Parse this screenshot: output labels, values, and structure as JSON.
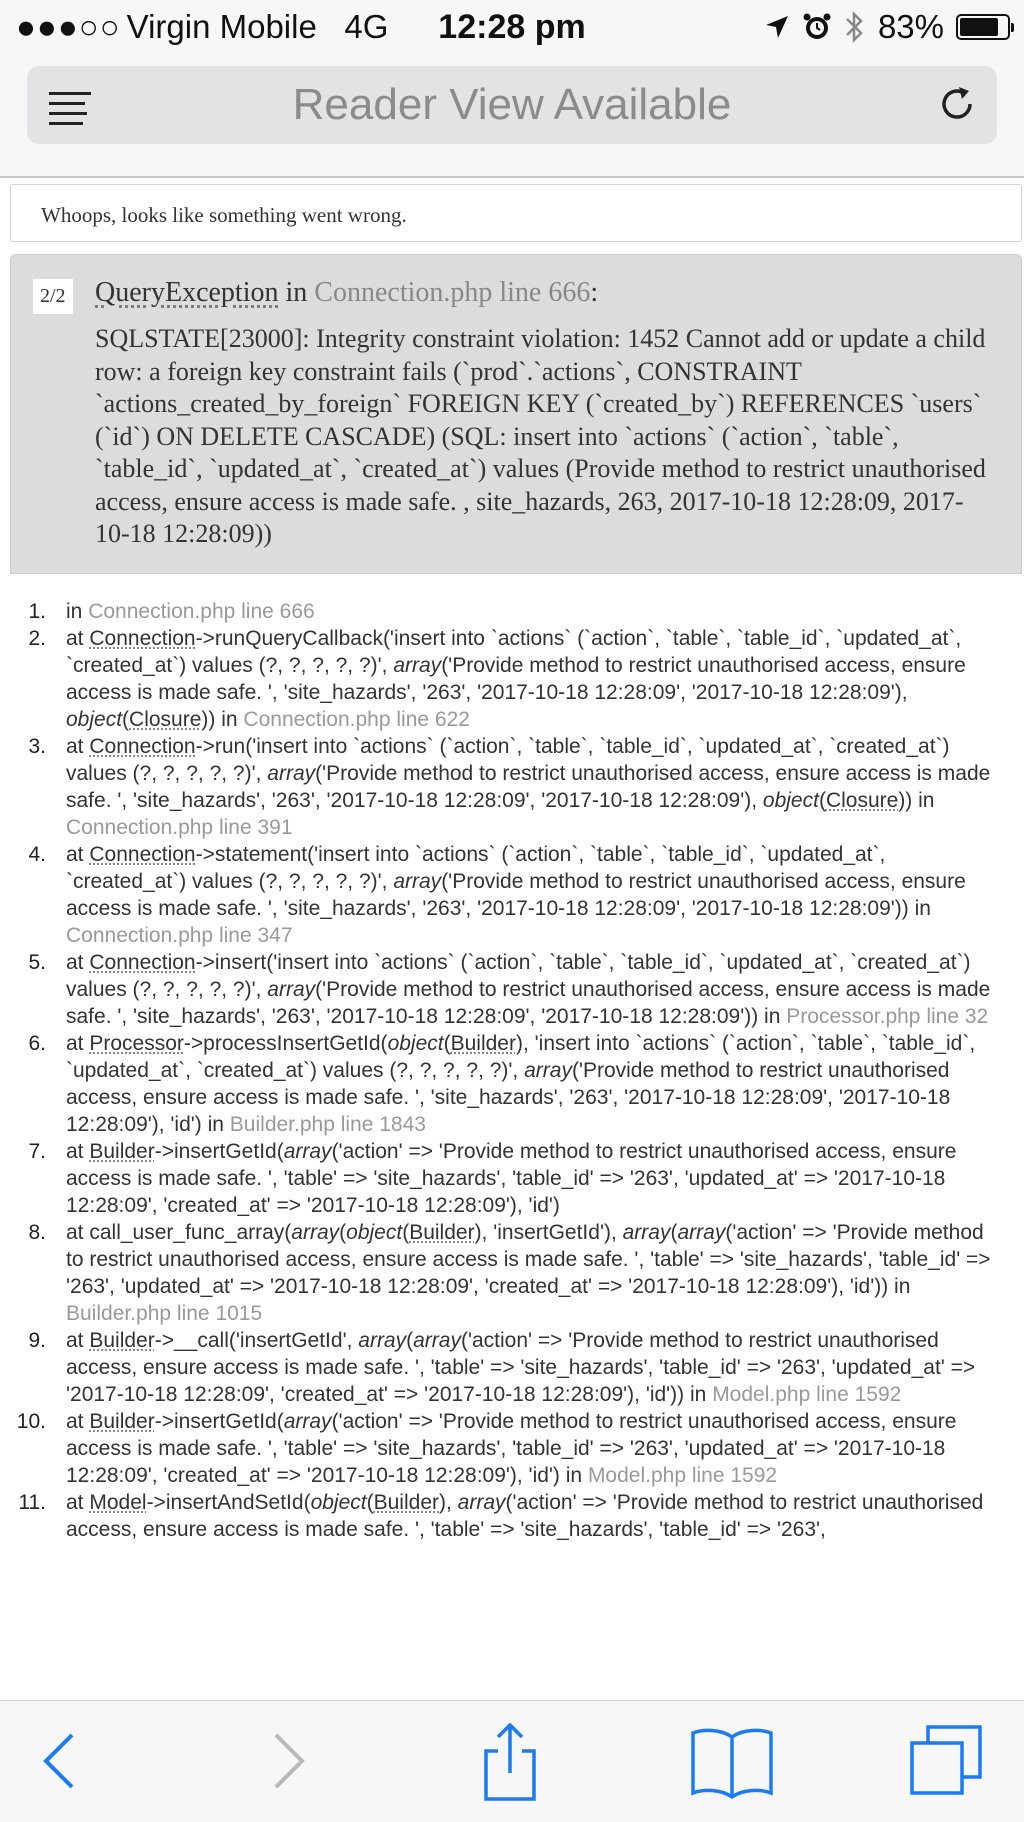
{
  "status": {
    "signal_dots": "●●●○○",
    "carrier": "Virgin Mobile",
    "network": "4G",
    "time": "12:28 pm",
    "battery_percent": "83%",
    "battery_level": 0.83
  },
  "navbar": {
    "title": "Reader View Available"
  },
  "page": {
    "whoops": "Whoops, looks like something went wrong.",
    "exception": {
      "count": "2/2",
      "class": "QueryException",
      "in_word": " in ",
      "location": "Connection.php line 666",
      "colon": ":",
      "message": "SQLSTATE[23000]: Integrity constraint violation: 1452 Cannot add or update a child row: a foreign key constraint fails (`prod`.`actions`, CONSTRAINT `actions_created_by_foreign` FOREIGN KEY (`created_by`) REFERENCES `users` (`id`) ON DELETE CASCADE) (SQL: insert into `actions` (`action`, `table`, `table_id`, `updated_at`, `created_at`) values (Provide method to restrict unauthorised access, ensure access is made safe. , site_hazards, 263, 2017-10-18 12:28:09, 2017-10-18 12:28:09))"
    },
    "trace": [
      {
        "num": "1.",
        "parts": [
          {
            "t": "in "
          },
          {
            "t": "Connection.php line 666",
            "k": "loc"
          }
        ]
      },
      {
        "num": "2.",
        "parts": [
          {
            "t": "at "
          },
          {
            "t": "Connection",
            "k": "cls"
          },
          {
            "t": "->runQueryCallback('insert into `actions` (`action`, `table`, `table_id`, `updated_at`, `created_at`) values (?, ?, ?, ?, ?)', "
          },
          {
            "t": "array",
            "k": "em"
          },
          {
            "t": "('Provide method to restrict unauthorised access, ensure access is made safe. ', 'site_hazards', '263', '2017-10-18 12:28:09', '2017-10-18 12:28:09'), "
          },
          {
            "t": "object",
            "k": "em"
          },
          {
            "t": "("
          },
          {
            "t": "Closure",
            "k": "cls"
          },
          {
            "t": ")) in "
          },
          {
            "t": "Connection.php line 622",
            "k": "loc"
          }
        ]
      },
      {
        "num": "3.",
        "parts": [
          {
            "t": "at "
          },
          {
            "t": "Connection",
            "k": "cls"
          },
          {
            "t": "->run('insert into `actions` (`action`, `table`, `table_id`, `updated_at`, `created_at`) values (?, ?, ?, ?, ?)', "
          },
          {
            "t": "array",
            "k": "em"
          },
          {
            "t": "('Provide method to restrict unauthorised access, ensure access is made safe. ', 'site_hazards', '263', '2017-10-18 12:28:09', '2017-10-18 12:28:09'), "
          },
          {
            "t": "object",
            "k": "em"
          },
          {
            "t": "("
          },
          {
            "t": "Closure",
            "k": "cls"
          },
          {
            "t": ")) in "
          },
          {
            "t": "Connection.php line 391",
            "k": "loc"
          }
        ]
      },
      {
        "num": "4.",
        "parts": [
          {
            "t": "at "
          },
          {
            "t": "Connection",
            "k": "cls"
          },
          {
            "t": "->statement('insert into `actions` (`action`, `table`, `table_id`, `updated_at`, `created_at`) values (?, ?, ?, ?, ?)', "
          },
          {
            "t": "array",
            "k": "em"
          },
          {
            "t": "('Provide method to restrict unauthorised access, ensure access is made safe. ', 'site_hazards', '263', '2017-10-18 12:28:09', '2017-10-18 12:28:09')) in "
          },
          {
            "t": "Connection.php line 347",
            "k": "loc"
          }
        ]
      },
      {
        "num": "5.",
        "parts": [
          {
            "t": "at "
          },
          {
            "t": "Connection",
            "k": "cls"
          },
          {
            "t": "->insert('insert into `actions` (`action`, `table`, `table_id`, `updated_at`, `created_at`) values (?, ?, ?, ?, ?)', "
          },
          {
            "t": "array",
            "k": "em"
          },
          {
            "t": "('Provide method to restrict unauthorised access, ensure access is made safe. ', 'site_hazards', '263', '2017-10-18 12:28:09', '2017-10-18 12:28:09')) in "
          },
          {
            "t": "Processor.php line 32",
            "k": "loc"
          }
        ]
      },
      {
        "num": "6.",
        "parts": [
          {
            "t": "at "
          },
          {
            "t": "Processor",
            "k": "cls"
          },
          {
            "t": "->processInsertGetId("
          },
          {
            "t": "object",
            "k": "em"
          },
          {
            "t": "("
          },
          {
            "t": "Builder",
            "k": "cls"
          },
          {
            "t": "), 'insert into `actions` (`action`, `table`, `table_id`, `updated_at`, `created_at`) values (?, ?, ?, ?, ?)', "
          },
          {
            "t": "array",
            "k": "em"
          },
          {
            "t": "('Provide method to restrict unauthorised access, ensure access is made safe. ', 'site_hazards', '263', '2017-10-18 12:28:09', '2017-10-18 12:28:09'), 'id') in "
          },
          {
            "t": "Builder.php line 1843",
            "k": "loc"
          }
        ]
      },
      {
        "num": "7.",
        "parts": [
          {
            "t": "at "
          },
          {
            "t": "Builder",
            "k": "cls"
          },
          {
            "t": "->insertGetId("
          },
          {
            "t": "array",
            "k": "em"
          },
          {
            "t": "('action' => 'Provide method to restrict unauthorised access, ensure access is made safe. ', 'table' => 'site_hazards', 'table_id' => '263', 'updated_at' => '2017-10-18 12:28:09', 'created_at' => '2017-10-18 12:28:09'), 'id')"
          }
        ]
      },
      {
        "num": "8.",
        "parts": [
          {
            "t": "at call_user_func_array("
          },
          {
            "t": "array",
            "k": "em"
          },
          {
            "t": "("
          },
          {
            "t": "object",
            "k": "em"
          },
          {
            "t": "("
          },
          {
            "t": "Builder",
            "k": "cls"
          },
          {
            "t": "), 'insertGetId'), "
          },
          {
            "t": "array",
            "k": "em"
          },
          {
            "t": "("
          },
          {
            "t": "array",
            "k": "em"
          },
          {
            "t": "('action' => 'Provide method to restrict unauthorised access, ensure access is made safe. ', 'table' => 'site_hazards', 'table_id' => '263', 'updated_at' => '2017-10-18 12:28:09', 'created_at' => '2017-10-18 12:28:09'), 'id')) in "
          },
          {
            "t": "Builder.php line 1015",
            "k": "loc"
          }
        ]
      },
      {
        "num": "9.",
        "parts": [
          {
            "t": "at "
          },
          {
            "t": "Builder",
            "k": "cls"
          },
          {
            "t": "->__call('insertGetId', "
          },
          {
            "t": "array",
            "k": "em"
          },
          {
            "t": "("
          },
          {
            "t": "array",
            "k": "em"
          },
          {
            "t": "('action' => 'Provide method to restrict unauthorised access, ensure access is made safe. ', 'table' => 'site_hazards', 'table_id' => '263', 'updated_at' => '2017-10-18 12:28:09', 'created_at' => '2017-10-18 12:28:09'), 'id')) in "
          },
          {
            "t": "Model.php line 1592",
            "k": "loc"
          }
        ]
      },
      {
        "num": "10.",
        "parts": [
          {
            "t": "at "
          },
          {
            "t": "Builder",
            "k": "cls"
          },
          {
            "t": "->insertGetId("
          },
          {
            "t": "array",
            "k": "em"
          },
          {
            "t": "('action' => 'Provide method to restrict unauthorised access, ensure access is made safe. ', 'table' => 'site_hazards', 'table_id' => '263', 'updated_at' => '2017-10-18 12:28:09', 'created_at' => '2017-10-18 12:28:09'), 'id') in "
          },
          {
            "t": "Model.php line 1592",
            "k": "loc"
          }
        ]
      },
      {
        "num": "11.",
        "parts": [
          {
            "t": "at "
          },
          {
            "t": "Model",
            "k": "cls"
          },
          {
            "t": "->insertAndSetId("
          },
          {
            "t": "object",
            "k": "em"
          },
          {
            "t": "("
          },
          {
            "t": "Builder",
            "k": "cls"
          },
          {
            "t": "), "
          },
          {
            "t": "array",
            "k": "em"
          },
          {
            "t": "('action' => 'Provide method to restrict unauthorised access, ensure access is made safe. ', 'table' => 'site_hazards', 'table_id' => '263',"
          }
        ]
      }
    ]
  },
  "toolbar": {
    "icons": [
      "back-icon",
      "forward-icon",
      "share-icon",
      "bookmarks-icon",
      "tabs-icon"
    ]
  },
  "colors": {
    "accent": "#1a7cf5",
    "disabled": "#b8b8b8",
    "exception_bg": "#dcdcdc",
    "location_text": "#999999"
  }
}
